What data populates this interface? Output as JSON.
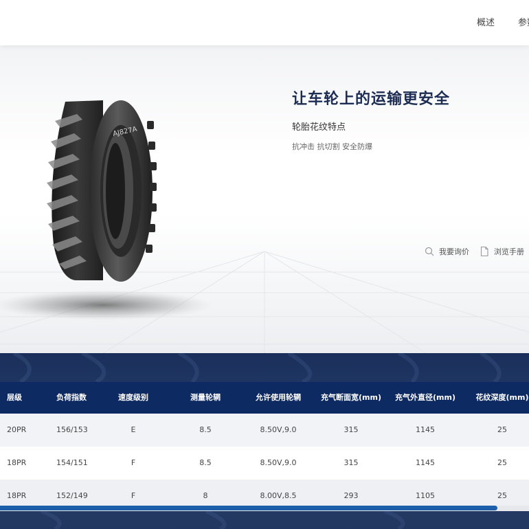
{
  "nav": {
    "items": [
      "概述",
      "参数"
    ]
  },
  "hero": {
    "title": "让车轮上的运输更安全",
    "subtitle": "轮胎花纹特点",
    "features": "抗冲击 抗切割 安全防爆",
    "tire_marking": "AJ827A",
    "actions": {
      "inquiry": "我要询价",
      "manual": "浏览手册"
    }
  },
  "icons": {
    "inquiry": "search-icon",
    "manual": "document-icon"
  },
  "colors": {
    "title": "#1c2c52",
    "table_header": "#0e2a62",
    "scrollbar": "#1d5fa8"
  },
  "table": {
    "headers": [
      "层级",
      "负荷指数",
      "速度级别",
      "测量轮辋",
      "允许使用轮辋",
      "充气断面宽(mm)",
      "充气外直径(mm)",
      "花纹深度(mm)"
    ],
    "rows": [
      [
        "20PR",
        "156/153",
        "E",
        "8.5",
        "8.50V,9.0",
        "315",
        "1145",
        "25"
      ],
      [
        "18PR",
        "154/151",
        "F",
        "8.5",
        "8.50V,9.0",
        "315",
        "1145",
        "25"
      ],
      [
        "18PR",
        "152/149",
        "F",
        "8",
        "8.00V,8.5",
        "293",
        "1105",
        "25"
      ]
    ]
  }
}
